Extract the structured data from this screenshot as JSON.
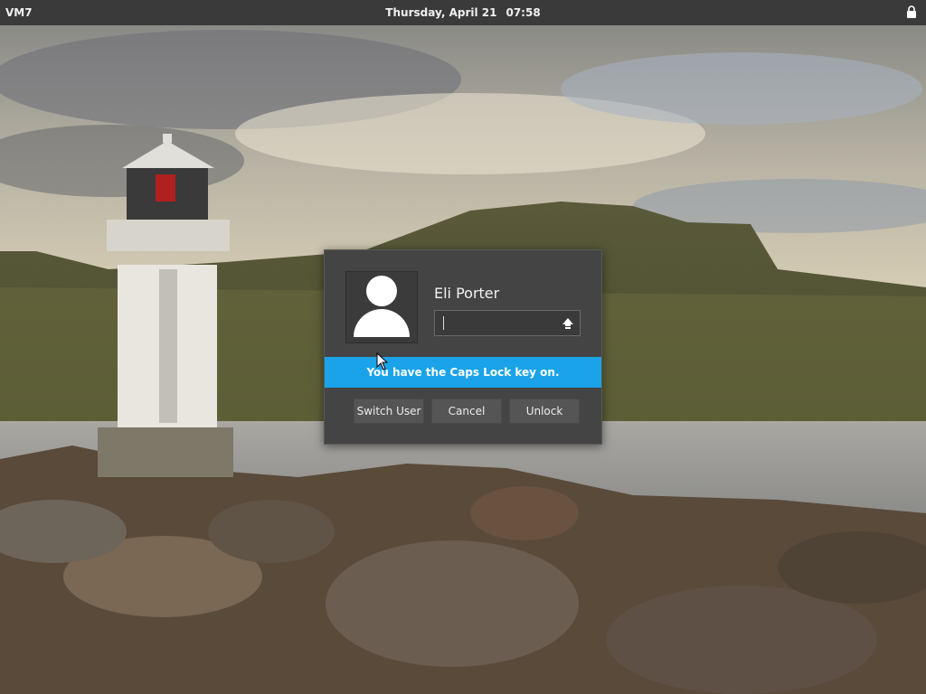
{
  "topbar": {
    "vm_name": "VM7",
    "date": "Thursday, April 21",
    "time": "07:58",
    "lock_icon": "lock-icon"
  },
  "dialog": {
    "avatar_icon": "user-avatar-icon",
    "username": "Eli Porter",
    "password_value": "",
    "capslock_icon": "capslock-indicator-icon",
    "caps_warning": "You have the Caps Lock key on.",
    "buttons": {
      "switch_user": "Switch User",
      "cancel": "Cancel",
      "unlock": "Unlock"
    }
  },
  "colors": {
    "panel": "#3a3a3a",
    "dialog": "#444444",
    "banner": "#1aa3e8"
  }
}
